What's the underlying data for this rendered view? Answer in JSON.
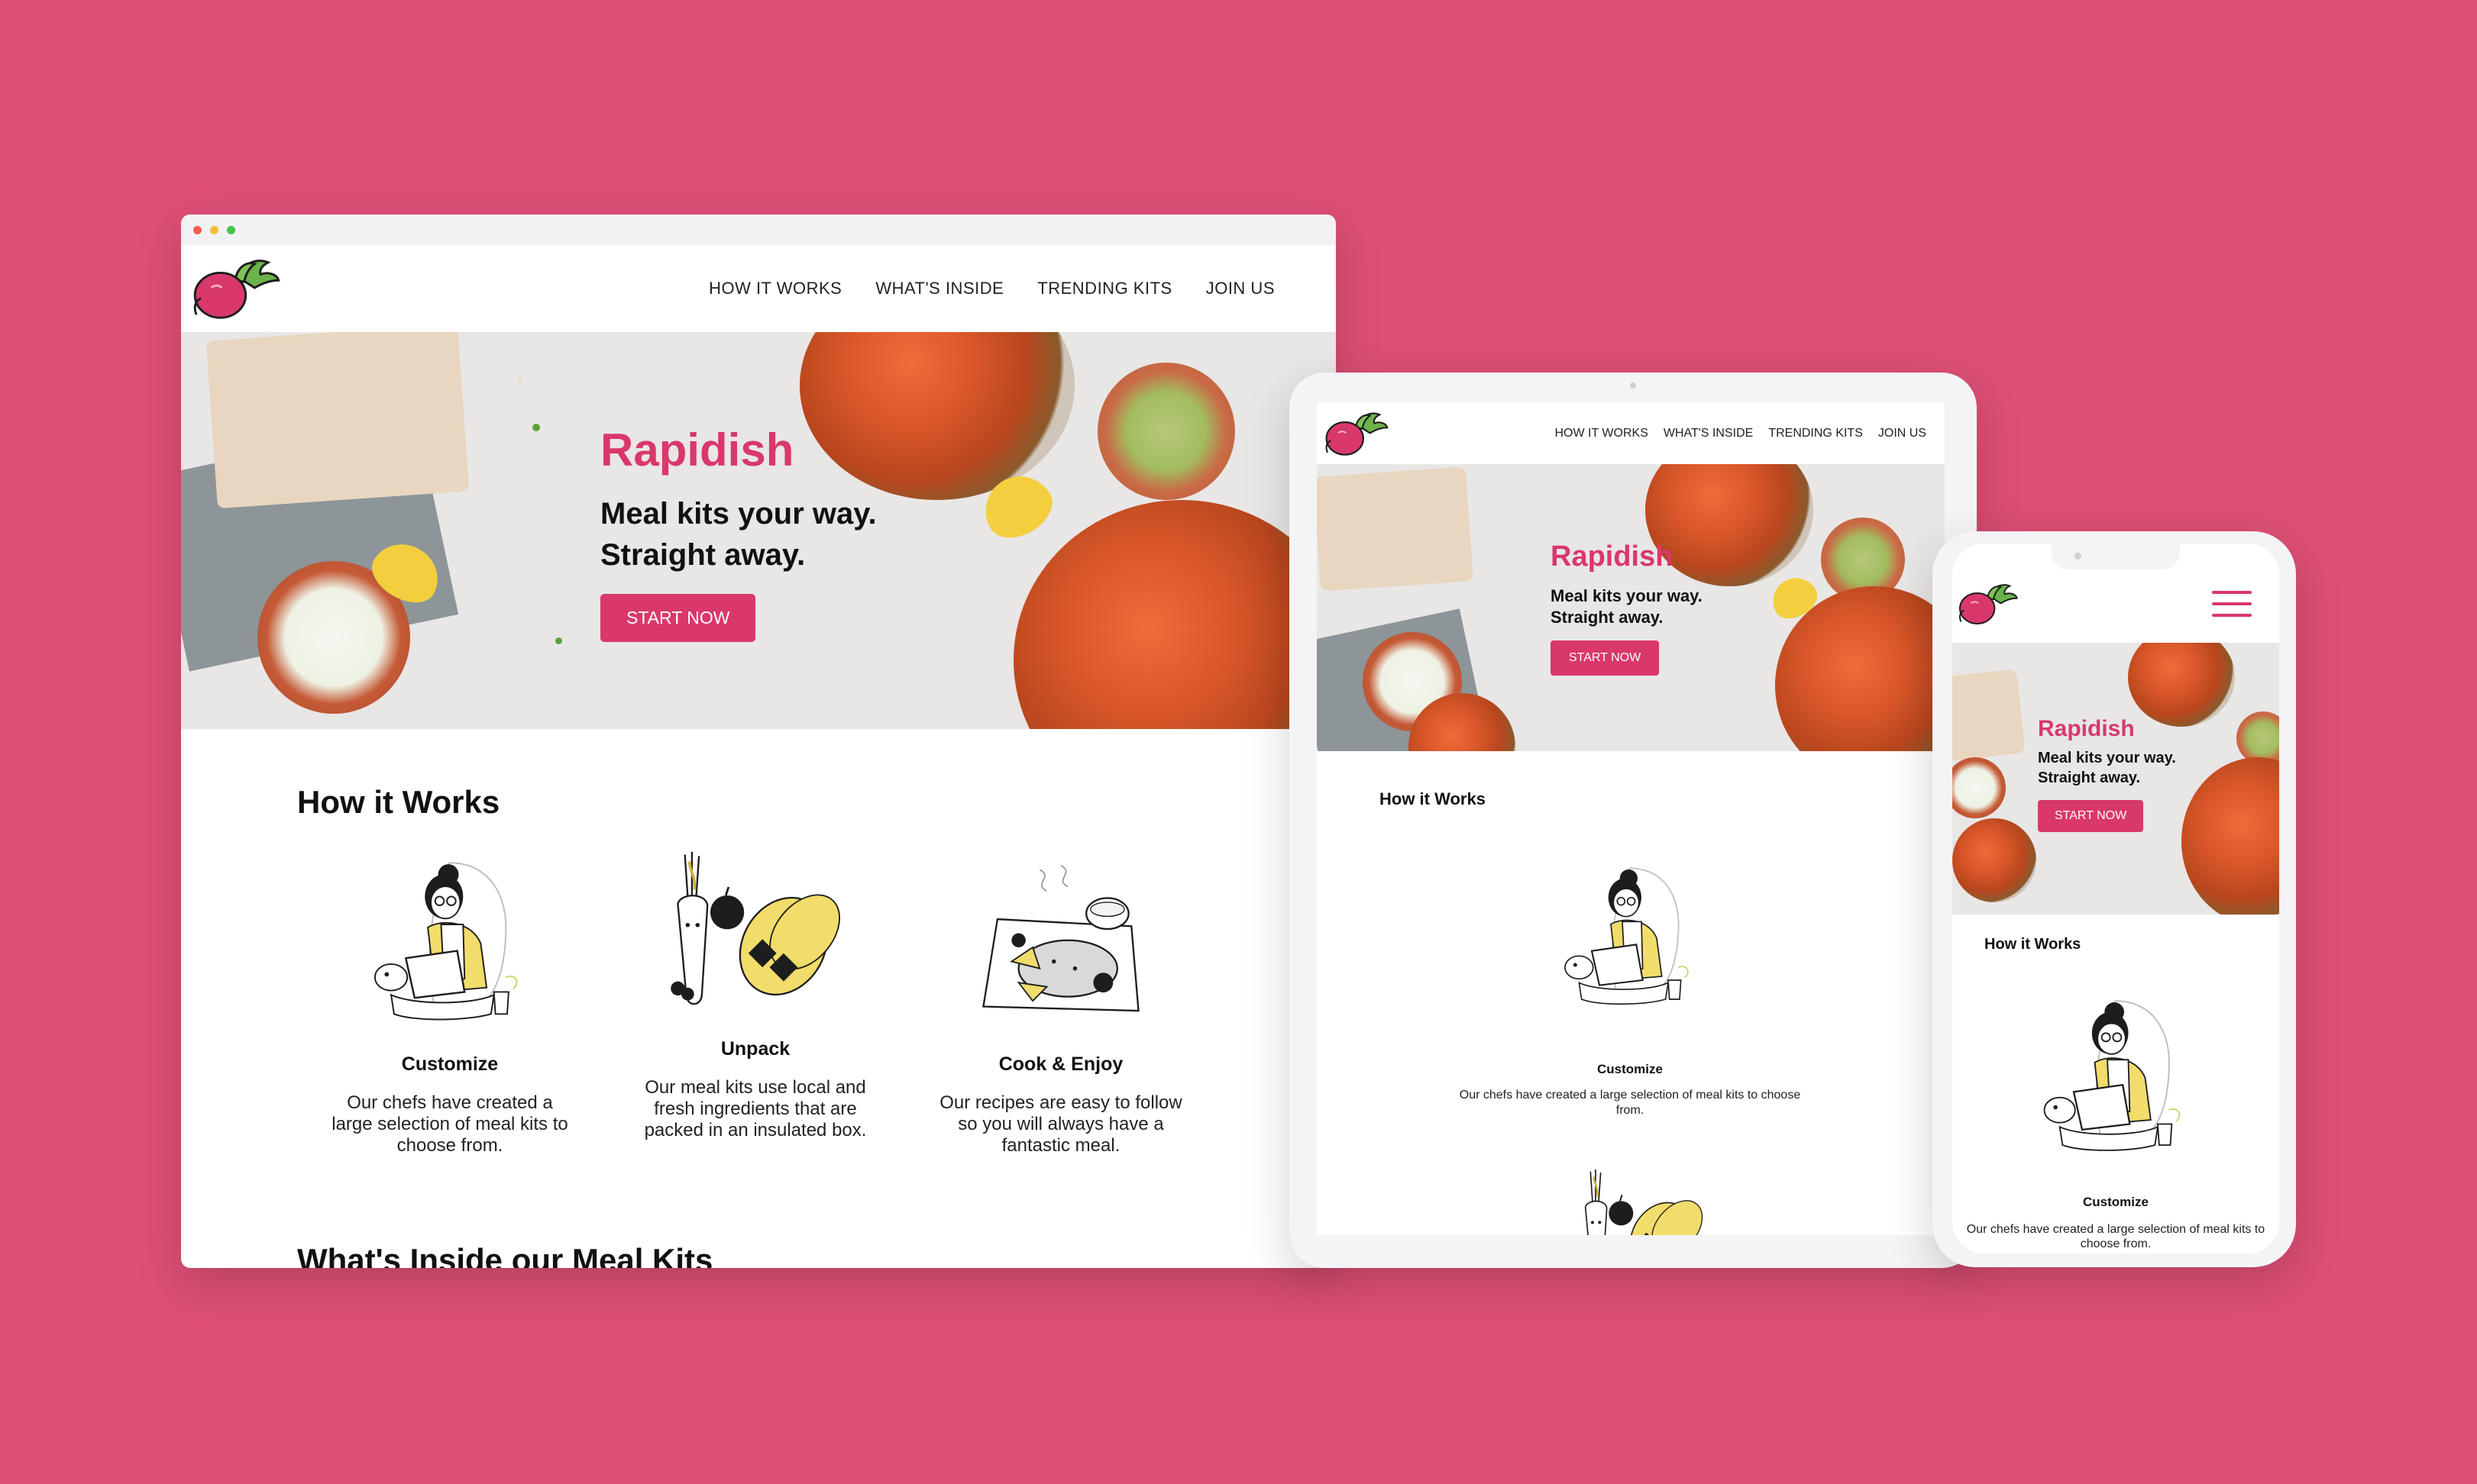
{
  "colors": {
    "background": "#de4f75",
    "accent": "#d9386a",
    "text": "#111111"
  },
  "site": {
    "logo_icon": "beet-logo-icon",
    "brand": "Rapidish",
    "tagline_line1": "Meal kits your way.",
    "tagline_line2": "Straight away.",
    "cta": "START NOW",
    "nav": [
      "HOW IT WORKS",
      "WHAT'S INSIDE",
      "TRENDING KITS",
      "JOIN US"
    ],
    "menu_icon": "hamburger-menu-icon"
  },
  "how_it_works": {
    "title": "How it Works",
    "steps": [
      {
        "title": "Customize",
        "desc": "Our chefs have created a large selection of meal kits to choose from.",
        "icon": "woman-laptop-illustration"
      },
      {
        "title": "Unpack",
        "desc": "Our meal kits use local and fresh ingredients that are packed in an insulated box.",
        "icon": "vegetables-illustration"
      },
      {
        "title": "Cook & Enjoy",
        "desc": "Our recipes are easy to follow so you will always have a fantastic meal.",
        "icon": "plated-meal-illustration"
      }
    ]
  },
  "next_section": {
    "title": "What's Inside our Meal Kits"
  }
}
